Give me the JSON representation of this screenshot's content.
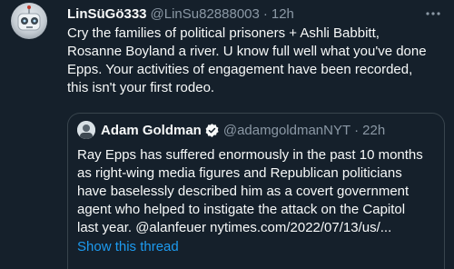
{
  "tweet": {
    "display_name": "LinSüGö333",
    "handle": "@LinSu82888003",
    "separator": "·",
    "time": "12h",
    "body_lines": [
      "Cry the families of political prisoners + Ashli Babbitt,",
      "Rosanne Boyland a river. U know full well what you've done",
      "Epps. Your activities of engagement have been recorded,",
      "this isn't your first rodeo."
    ]
  },
  "quote": {
    "display_name": "Adam Goldman",
    "handle": "@adamgoldmanNYT",
    "separator": "·",
    "time": "22h",
    "lines": [
      "Ray Epps has suffered enormously in the past 10 months",
      "as right-wing media figures and Republican politicians",
      "have baselessly described him as a covert government",
      "agent who helped to instigate the attack on the Capitol"
    ],
    "last_line_prefix": "last year. ",
    "mention": "@alanfeuer",
    "link": "nytimes.com/2022/07/13/us/...",
    "show_thread": "Show this thread"
  },
  "colors": {
    "background": "#15202b",
    "text": "#f7f9f9",
    "secondary": "#8b98a5",
    "accent": "#1d9bf0",
    "border": "#38444d"
  },
  "icons": {
    "more": "more-horizontal-icon",
    "verified": "verified-badge-icon"
  }
}
